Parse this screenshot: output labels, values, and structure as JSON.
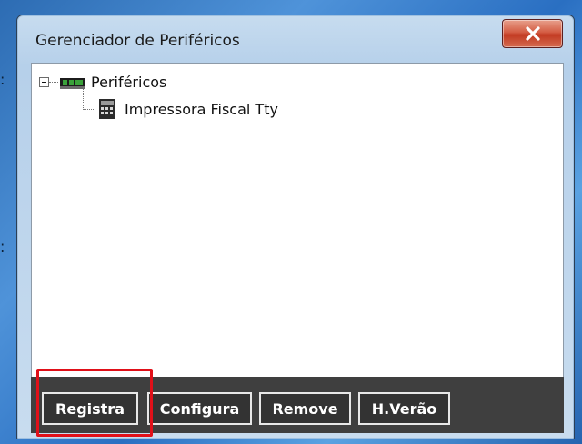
{
  "window": {
    "title": "Gerenciador de Periféricos"
  },
  "tree": {
    "root_label": "Periféricos",
    "children": [
      {
        "label": "Impressora Fiscal Tty"
      }
    ]
  },
  "buttons": {
    "registra": "Registra",
    "configura": "Configura",
    "remove": "Remove",
    "hverao": "H.Verão"
  },
  "highlight": {
    "color": "#e01019",
    "target": "registra"
  },
  "colors": {
    "button_bar": "#3f3f3f",
    "button_border": "#e8e8e8",
    "close_button": "#c23b22"
  },
  "icons": {
    "close": "close-icon",
    "root": "board-icon",
    "printer": "printer-icon",
    "expander": "tree-collapse-icon"
  }
}
